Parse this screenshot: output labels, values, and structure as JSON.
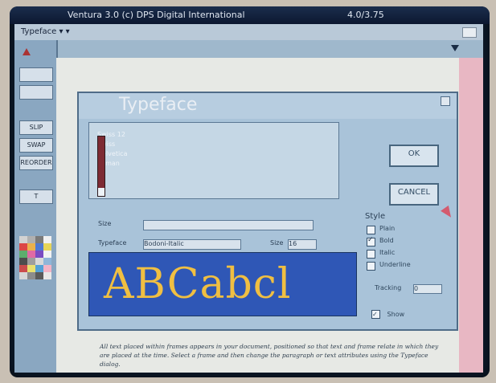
{
  "window": {
    "title": "Ventura 3.0 (c) DPS Digital International",
    "version": "4.0/3.75",
    "menu_label": "Typeface ▾ ▾"
  },
  "dialog": {
    "title": "Typeface",
    "font_list": [
      "Swiss 12",
      "Swiss",
      "Helvetica",
      "Roman"
    ],
    "ok_label": "OK",
    "cancel_label": "CANCEL",
    "fields": {
      "size_label": "Size",
      "size_value": "",
      "typeface_label": "Typeface",
      "typeface_value": "Bodoni-Italic",
      "size2_label": "Size",
      "size2_value": "16"
    },
    "preview_text": "ABCabcl",
    "style_title": "Style",
    "styles": [
      {
        "label": "Plain",
        "checked": false
      },
      {
        "label": "Bold",
        "checked": true
      },
      {
        "label": "Italic",
        "checked": false
      },
      {
        "label": "Underline",
        "checked": false
      }
    ],
    "tracking_label": "Tracking",
    "tracking_value": "0",
    "show_label": "Show",
    "show_checked": true
  },
  "toolbar_items": [
    "SLIP",
    "SWAP",
    "REORDER"
  ],
  "colors": {
    "accent": "#2f57b6",
    "preview_text": "#f0bf42",
    "scroll": "#7d2b34"
  },
  "document_text": "All text placed within frames appears in your document, positioned so that text and frame relate in which they are placed at the time. Select a frame and then change the paragraph or text attributes using the Typeface dialog."
}
